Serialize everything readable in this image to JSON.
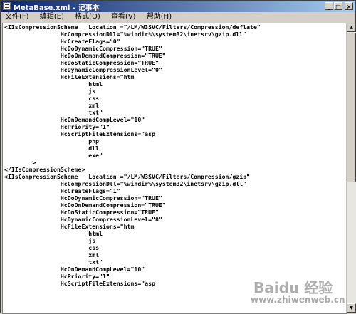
{
  "window": {
    "title": "MetaBase.xml - 记事本",
    "minimize": "_",
    "maximize": "□",
    "close": "×"
  },
  "menu": [
    "文件(F)",
    "编辑(E)",
    "格式(O)",
    "查看(V)",
    "帮助(H)"
  ],
  "editor": {
    "lines": [
      "<IIsCompressionScheme   Location =\"/LM/W3SVC/Filters/Compression/deflate\"",
      "                HcCompressionDll=\"%windir%\\system32\\inetsrv\\gzip.dll\"",
      "                HcCreateFlags=\"0\"",
      "                HcDoDynamicCompression=\"TRUE\"",
      "                HcDoOnDemandCompression=\"TRUE\"",
      "                HcDoStaticCompression=\"TRUE\"",
      "                HcDynamicCompressionLevel=\"0\"",
      "                HcFileExtensions=\"htm",
      "                        html",
      "                        js",
      "                        css",
      "                        xml",
      "                        txt\"",
      "                HcOnDemandCompLevel=\"10\"",
      "                HcPriority=\"1\"",
      "                HcScriptFileExtensions=\"asp",
      "                        php",
      "                        dll",
      "                        exe\"",
      "        >",
      "</IIsCompressionScheme>",
      "<IIsCompressionScheme   Location =\"/LM/W3SVC/Filters/Compression/gzip\"",
      "                HcCompressionDll=\"%windir%\\system32\\inetsrv\\gzip.dll\"",
      "                HcCreateFlags=\"1\"",
      "                HcDoDynamicCompression=\"TRUE\"",
      "                HcDoOnDemandCompression=\"TRUE\"",
      "                HcDoStaticCompression=\"TRUE\"",
      "                HcDynamicCompressionLevel=\"8\"",
      "                HcFileExtensions=\"htm",
      "                        html",
      "                        js",
      "                        css",
      "                        xml",
      "                        txt\"",
      "                HcOnDemandCompLevel=\"10\"",
      "                HcPriority=\"1\"",
      "                HcScriptFileExtensions=\"asp"
    ]
  },
  "watermark": {
    "brand": "Baidu 经验",
    "url": "www.zhiwenweb.cn"
  }
}
